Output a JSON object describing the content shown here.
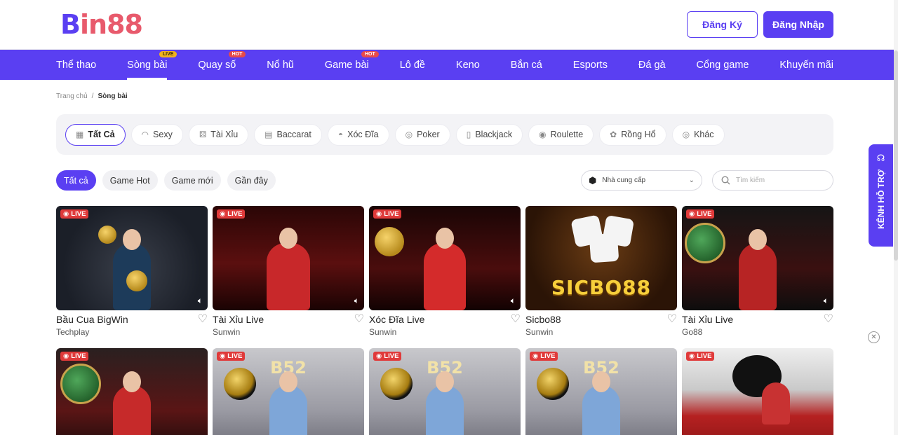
{
  "logo": {
    "b": "B",
    "rest": "in88"
  },
  "auth": {
    "register": "Đăng Ký",
    "login": "Đăng Nhập"
  },
  "nav": [
    {
      "label": "Thể thao",
      "badge": ""
    },
    {
      "label": "Sòng bài",
      "badge": "LIVE"
    },
    {
      "label": "Quay số",
      "badge": "HOT"
    },
    {
      "label": "Nổ hũ",
      "badge": ""
    },
    {
      "label": "Game bài",
      "badge": "HOT"
    },
    {
      "label": "Lô đề",
      "badge": ""
    },
    {
      "label": "Keno",
      "badge": ""
    },
    {
      "label": "Bắn cá",
      "badge": ""
    },
    {
      "label": "Esports",
      "badge": ""
    },
    {
      "label": "Đá gà",
      "badge": ""
    },
    {
      "label": "Cổng game",
      "badge": ""
    },
    {
      "label": "Khuyến mãi",
      "badge": ""
    }
  ],
  "breadcrumb": {
    "home": "Trang chủ",
    "sep": "/",
    "current": "Sòng bài"
  },
  "categories": [
    {
      "label": "Tất Cả",
      "icon": "grid-icon"
    },
    {
      "label": "Sexy",
      "icon": "lips-icon"
    },
    {
      "label": "Tài Xỉu",
      "icon": "dice-icon"
    },
    {
      "label": "Baccarat",
      "icon": "cards-icon"
    },
    {
      "label": "Xóc Đĩa",
      "icon": "bowl-icon"
    },
    {
      "label": "Poker",
      "icon": "chip-icon"
    },
    {
      "label": "Blackjack",
      "icon": "card-icon"
    },
    {
      "label": "Roulette",
      "icon": "roulette-icon"
    },
    {
      "label": "Rồng Hổ",
      "icon": "tiger-icon"
    },
    {
      "label": "Khác",
      "icon": "chip-icon"
    }
  ],
  "filters": [
    "Tất cả",
    "Game Hot",
    "Game mới",
    "Gần đây"
  ],
  "provider": {
    "label": "Nhà cung cấp"
  },
  "search": {
    "placeholder": "Tìm kiếm"
  },
  "live_label": "LIVE",
  "games": [
    {
      "name": "Bầu Cua BigWin",
      "provider": "Techplay",
      "live": true
    },
    {
      "name": "Tài Xỉu Live",
      "provider": "Sunwin",
      "live": true
    },
    {
      "name": "Xóc Đĩa Live",
      "provider": "Sunwin",
      "live": true
    },
    {
      "name": "Sicbo88",
      "provider": "Sunwin",
      "live": false
    },
    {
      "name": "Tài Xỉu Live",
      "provider": "Go88",
      "live": true
    },
    {
      "name": "",
      "provider": "",
      "live": true
    },
    {
      "name": "",
      "provider": "",
      "live": true
    },
    {
      "name": "",
      "provider": "",
      "live": true
    },
    {
      "name": "",
      "provider": "",
      "live": true
    },
    {
      "name": "",
      "provider": "",
      "live": true
    }
  ],
  "sicbo_text": "SICBO88",
  "b52_text": "B52",
  "support": {
    "label": "KÊNH HỖ TRỢ"
  },
  "colors": {
    "brand": "#5a3ff2",
    "live_red": "#e03a3a",
    "hot": "#e64a4a",
    "live_badge": "#f2b21e"
  }
}
